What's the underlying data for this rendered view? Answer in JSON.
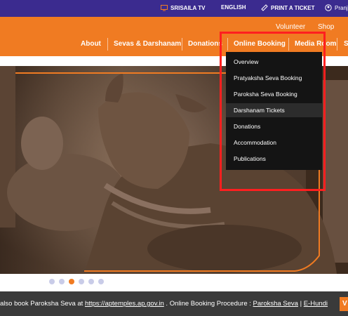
{
  "topbar": {
    "tv_label": "SRISAILA TV",
    "lang_label": "ENGLISH",
    "ticket_label": "PRINT A TICKET",
    "user_label": "Pranj"
  },
  "util_nav": {
    "volunteer": "Volunteer",
    "shop": "Shop"
  },
  "nav": {
    "about": "About",
    "sevas": "Sevas & Darshanam",
    "donations": "Donations",
    "online_booking": "Online Booking",
    "media_room": "Media Room",
    "more": "S"
  },
  "dropdown": {
    "items": [
      "Overview",
      "Pratyaksha Seva Booking",
      "Paroksha Seva Booking",
      "Darshanam Tickets",
      "Donations",
      "Accommodation",
      "Publications"
    ],
    "hovered_index": 3
  },
  "slider": {
    "dot_count": 6,
    "active_index": 2
  },
  "ticker": {
    "prefix": "also book Paroksha Seva at ",
    "link_url_text": "https://aptemples.ap.gov.in",
    "middle": " . Online Booking Procedure : ",
    "link_paroksha": "Paroksha Seva",
    "pipe": " | ",
    "link_ehundi": "E-Hundi",
    "cta": "V"
  },
  "colors": {
    "topbar": "#3b2b8f",
    "header": "#f07b22",
    "dropdown": "#141414",
    "highlight": "#ff1f1f"
  }
}
